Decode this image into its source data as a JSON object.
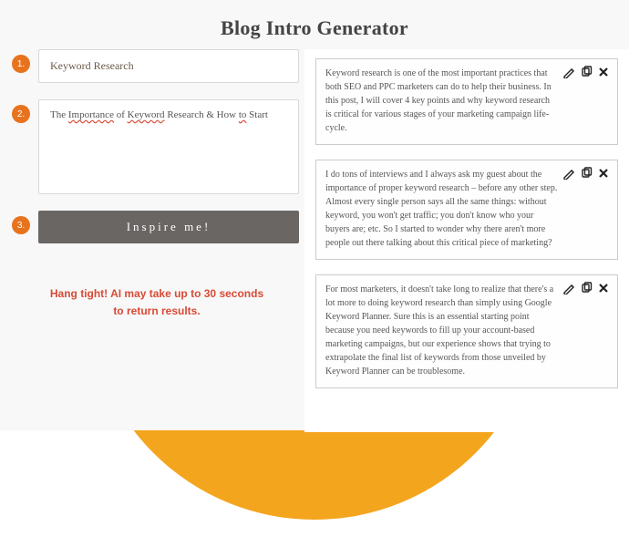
{
  "title": "Blog Intro Generator",
  "badges": {
    "one": "1.",
    "two": "2.",
    "three": "3."
  },
  "form": {
    "keyword_value": "Keyword Research",
    "topic_segments": [
      {
        "t": "The "
      },
      {
        "t": "Importance",
        "wavy": true
      },
      {
        "t": " of "
      },
      {
        "t": "Keyword",
        "wavy": true
      },
      {
        "t": " Research & How "
      },
      {
        "t": "to",
        "wavy": true
      },
      {
        "t": " Start"
      }
    ],
    "button_label": "Inspire me!"
  },
  "note_line1": "Hang tight! AI may take up to 30 seconds",
  "note_line2": "to return results.",
  "results": [
    "Keyword research is one of the most important practices that both SEO and PPC marketers can do to help their business. In this post, I will cover 4 key points and why keyword research is critical for various stages of your marketing campaign life-cycle.",
    "I do tons of interviews and I always ask my guest about the importance of proper keyword research – before any other step. Almost every single person says all the same things: without keyword, you won't get traffic; you don't know who your buyers are; etc. So I started to wonder why there aren't more people out there talking about this critical piece of marketing?",
    "For most marketers, it doesn't take long to realize that there's a lot more to doing keyword research than simply using Google Keyword Planner. Sure this is an essential starting point because you need keywords to fill up your account-based marketing campaigns, but our experience shows that trying to extrapolate the final list of keywords from those unveiled by Keyword Planner can be troublesome."
  ]
}
